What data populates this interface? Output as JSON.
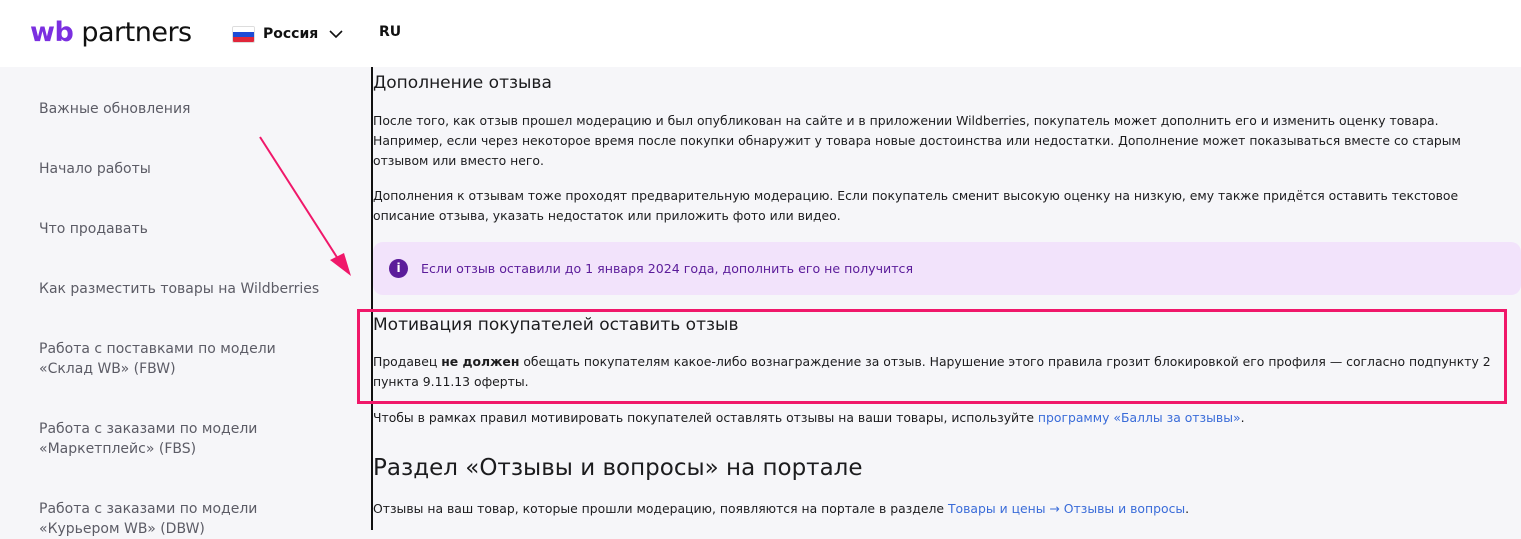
{
  "header": {
    "logo_prefix": "wb",
    "logo_suffix": " partners",
    "country": "Россия",
    "language": "RU",
    "flag_colors": [
      "#ffffff",
      "#1d4bd6",
      "#e0263a"
    ]
  },
  "sidebar": {
    "items": [
      {
        "label": "Важные обновления"
      },
      {
        "label": "Начало работы"
      },
      {
        "label": "Что продавать"
      },
      {
        "label": "Как разместить товары на Wildberries"
      },
      {
        "label": "Работа с поставками по модели «Склад WB» (FBW)"
      },
      {
        "label": "Работа с заказами по модели «Маркетплейс» (FBS)"
      },
      {
        "label": "Работа с заказами по модели «Курьером WB» (DBW)"
      }
    ]
  },
  "content": {
    "section1_title": "Дополнение отзыва",
    "section1_p1": "После того, как отзыв прошел модерацию и был опубликован на сайте и в приложении Wildberries, покупатель может дополнить его и изменить оценку товара. Например, если через некоторое время после покупки обнаружит у товара новые достоинства или недостатки. Дополнение может показываться вместе со старым отзывом или вместо него.",
    "section1_p2": "Дополнения к отзывам тоже проходят предварительную модерацию. Если покупатель сменит высокую оценку на низкую, ему также придётся оставить текстовое описание отзыва, указать недостаток или приложить фото или видео.",
    "note_icon": "i",
    "note_text": "Если отзыв оставили до 1 января 2024 года, дополнить его не получится",
    "section2_title": "Мотивация покупателей оставить отзыв",
    "section2_p1_before": "Продавец ",
    "section2_p1_bold": "не должен",
    "section2_p1_after": " обещать покупателям какое-либо вознаграждение за отзыв. Нарушение этого правила грозит блокировкой его профиля — согласно подпункту 2 пункта 9.11.13 оферты.",
    "section2_p2_before": "Чтобы в рамках правил мотивировать покупателей оставлять отзывы на ваши товары, используйте ",
    "section2_p2_link": "программу «Баллы за отзывы»",
    "section2_p2_after": ".",
    "section3_title": "Раздел «Отзывы и вопросы» на портале",
    "section3_p1_before": "Отзывы на ваш товар, которые прошли модерацию, появляются на портале в разделе ",
    "section3_p1_link": "Товары и цены → Отзывы и вопросы",
    "section3_p1_after": "."
  },
  "colors": {
    "brand": "#7b2fe0",
    "highlight": "#f0186a",
    "link": "#3a6cd9",
    "note_bg": "#f2e3fb",
    "note_text": "#5b1c9a"
  }
}
